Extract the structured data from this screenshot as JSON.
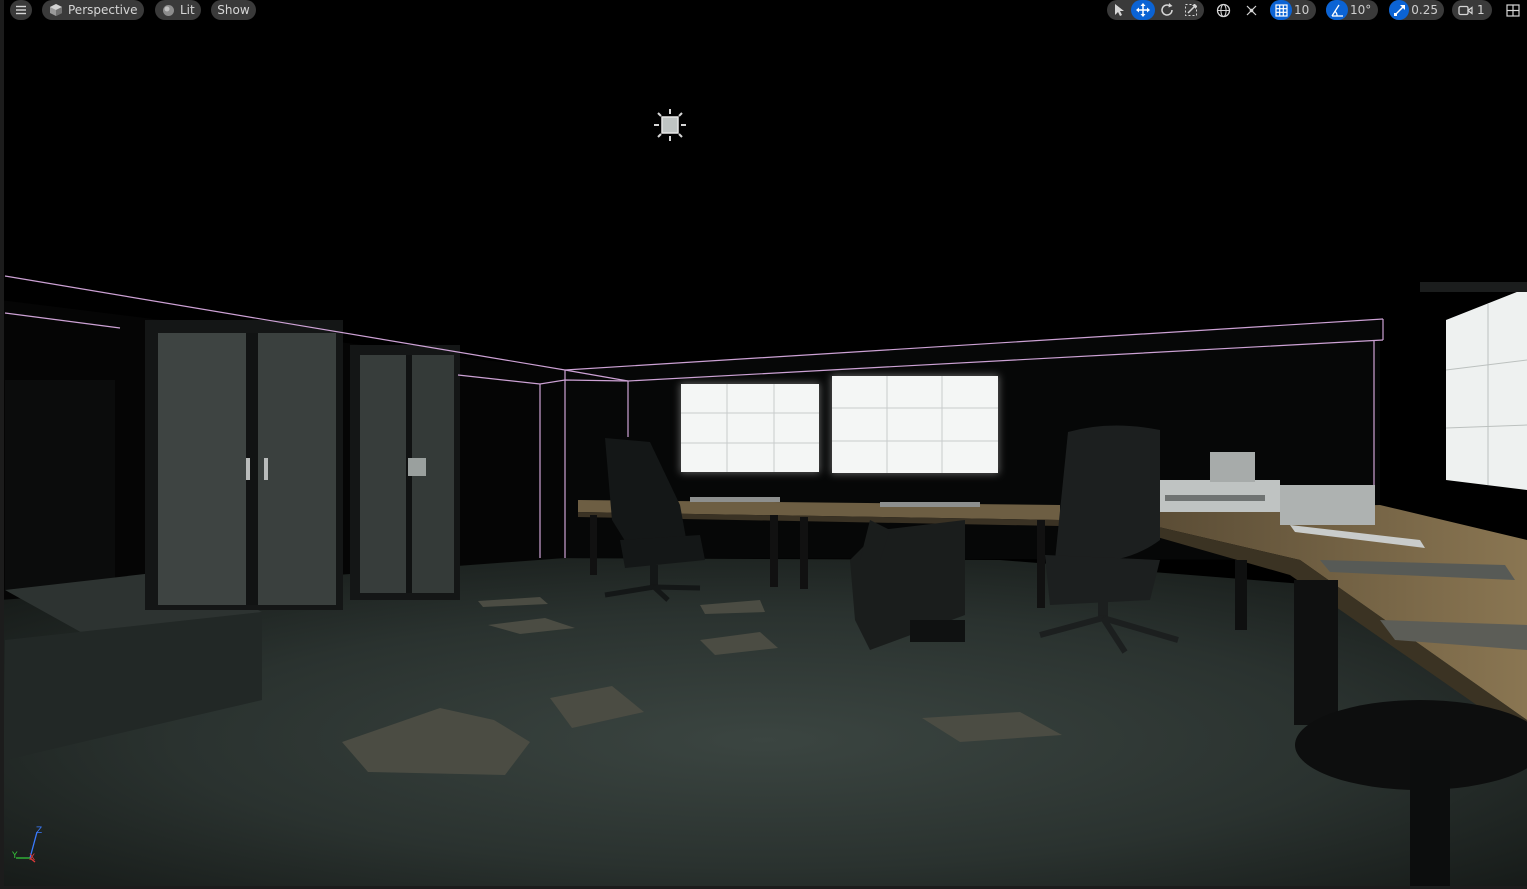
{
  "viewport": {
    "view_mode": "Perspective",
    "lighting_mode": "Lit",
    "show_label": "Show",
    "grid_snap": "10",
    "rotation_snap": "10°",
    "scale_snap": "0.25",
    "camera_speed": "1",
    "axis": {
      "z": "Z",
      "y": "Y",
      "x": "X"
    }
  },
  "icons": {
    "menu": "hamburger-menu-icon",
    "perspective": "cube-icon",
    "lit": "sphere-icon",
    "select": "arrow-cursor-icon",
    "translate": "move-arrows-icon",
    "rotate": "rotate-icon",
    "scale": "scale-icon",
    "world": "globe-icon",
    "surface_snap": "surface-snap-icon",
    "grid": "grid-icon",
    "angle": "angle-icon",
    "scale_snap": "scale-arrow-icon",
    "camera": "camera-icon",
    "layout": "viewport-layout-icon",
    "light": "light-source-icon"
  },
  "colors": {
    "toolbar_chip": "#3a3a3a",
    "active_blue": "#0b63d4",
    "selection_outline": "#e3b3ec"
  }
}
